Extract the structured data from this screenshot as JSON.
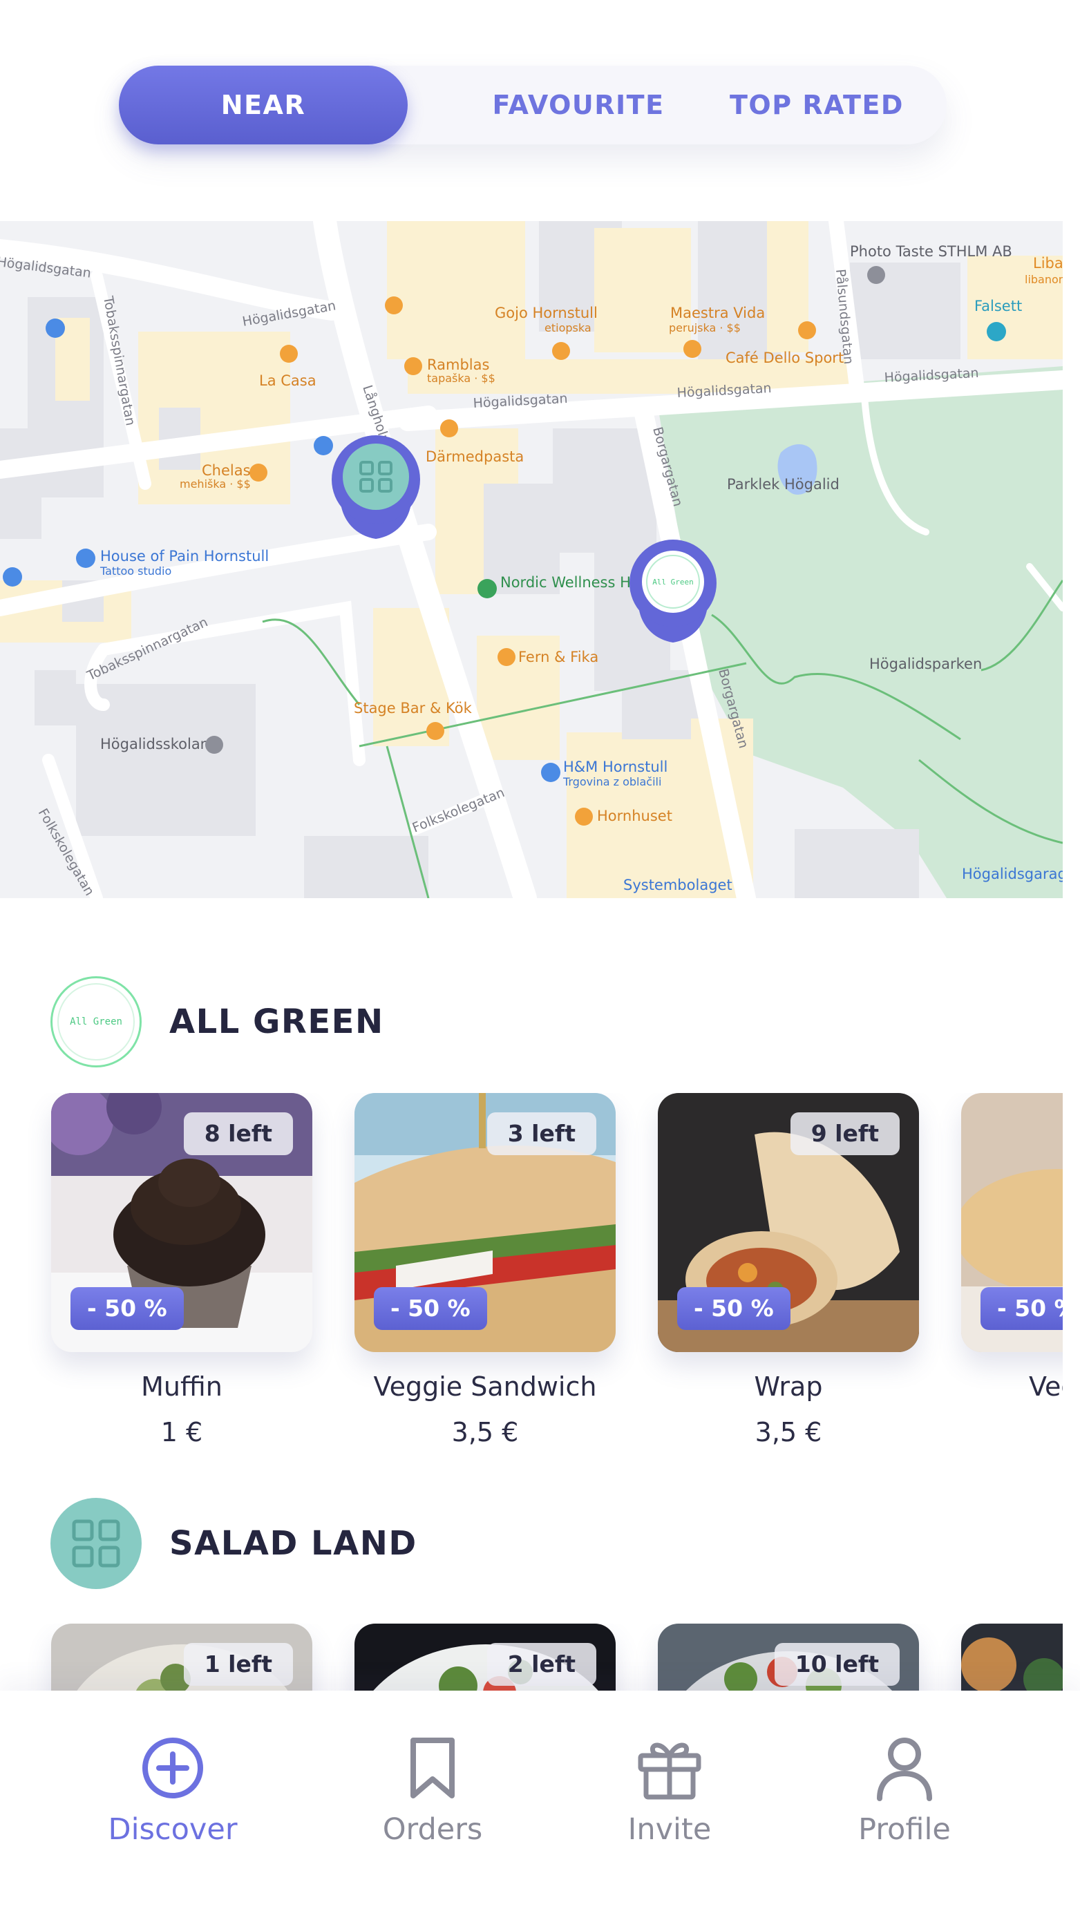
{
  "tabs": [
    {
      "label": "NEAR",
      "active": true
    },
    {
      "label": "FAVOURITE",
      "active": false
    },
    {
      "label": "TOP RATED",
      "active": false
    }
  ],
  "map": {
    "streets": [
      "Högalidsgatan",
      "Högalidsgatan",
      "Högalidsgatan",
      "Högalidsgatan",
      "Högalidsgatan",
      "Tobaksspinnargatan",
      "Tobaksspinnargatan",
      "Långholm",
      "Borgargatan",
      "Borgargatan",
      "Pålsundsgatan",
      "Folkskolegatan",
      "Folkskolegatan"
    ],
    "places": [
      {
        "name": "Photo Taste STHLM AB",
        "sub": "",
        "kind": "grey"
      },
      {
        "name": "Liba",
        "sub": "libanons",
        "kind": "orange"
      },
      {
        "name": "Falsett",
        "sub": "",
        "kind": "blue"
      },
      {
        "name": "Gojo Hornstull",
        "sub": "etiopska",
        "kind": "orange"
      },
      {
        "name": "Maestra Vida",
        "sub": "perujska · $$",
        "kind": "orange"
      },
      {
        "name": "Café Dello Sport",
        "sub": "",
        "kind": "orange"
      },
      {
        "name": "Ramblas",
        "sub": "tapaška · $$",
        "kind": "orange"
      },
      {
        "name": "La Casa",
        "sub": "",
        "kind": "orange"
      },
      {
        "name": "Därmedpasta",
        "sub": "",
        "kind": "orange"
      },
      {
        "name": "Chelas",
        "sub": "mehiška · $$",
        "kind": "orange"
      },
      {
        "name": "Parklek Högalid",
        "sub": "",
        "kind": "grey"
      },
      {
        "name": "House of Pain Hornstull",
        "sub": "Tattoo studio",
        "kind": "blue"
      },
      {
        "name": "Nordic Wellness Hornstull",
        "sub": "",
        "kind": "green"
      },
      {
        "name": "Fern & Fika",
        "sub": "",
        "kind": "orange"
      },
      {
        "name": "Högalidsparken",
        "sub": "",
        "kind": "grey"
      },
      {
        "name": "Stage Bar & Kök",
        "sub": "",
        "kind": "orange"
      },
      {
        "name": "Högalidsskolan",
        "sub": "",
        "kind": "grey"
      },
      {
        "name": "H&M Hornstull",
        "sub": "Trgovina z oblačili",
        "kind": "blue"
      },
      {
        "name": "Hornhuset",
        "sub": "",
        "kind": "orange"
      },
      {
        "name": "Systembolaget",
        "sub": "",
        "kind": "blue"
      },
      {
        "name": "Högalidsgarage",
        "sub": "",
        "kind": "blue"
      }
    ],
    "pins": [
      {
        "restaurant": "Salad Land",
        "icon": "grid-icon"
      },
      {
        "restaurant": "All Green",
        "icon": "all-green-logo",
        "logo_text": "All Green"
      }
    ]
  },
  "restaurants": [
    {
      "name": "ALL GREEN",
      "logo_text": "All Green",
      "products": [
        {
          "name": "Muffin",
          "price": "1 €",
          "left": "8 left",
          "discount": "- 50 %",
          "image": "muffin-photo"
        },
        {
          "name": "Veggie Sandwich",
          "price": "3,5 €",
          "left": "3 left",
          "discount": "- 50 %",
          "image": "sandwich-photo"
        },
        {
          "name": "Wrap",
          "price": "3,5 €",
          "left": "9 left",
          "discount": "- 50 %",
          "image": "wrap-photo"
        },
        {
          "name": "Veg",
          "price": "",
          "left": "",
          "discount": "- 50 %",
          "image": "bread-photo"
        }
      ]
    },
    {
      "name": "SALAD LAND",
      "logo_icon": "grid-icon",
      "products": [
        {
          "left": "1 left",
          "image": "salad-photo"
        },
        {
          "left": "2 left",
          "image": "salad-bowl-photo"
        },
        {
          "left": "10 left",
          "image": "salad-plate-photo"
        },
        {
          "left": "",
          "image": "food-photo"
        }
      ]
    }
  ],
  "nav": [
    {
      "label": "Discover",
      "icon": "plus-circle-icon",
      "active": true
    },
    {
      "label": "Orders",
      "icon": "bookmark-icon",
      "active": false
    },
    {
      "label": "Invite",
      "icon": "gift-icon",
      "active": false
    },
    {
      "label": "Profile",
      "icon": "user-icon",
      "active": false
    }
  ],
  "colors": {
    "accent": "#6c71e0",
    "accent_dark": "#5a5fcf",
    "park": "#cfe8d6",
    "map_bg": "#f1f2f5",
    "poi_orange": "#e89a2c",
    "poi_blue": "#4b8be5",
    "salad_land_teal": "#87cbc3",
    "all_green": "#4cc983"
  }
}
